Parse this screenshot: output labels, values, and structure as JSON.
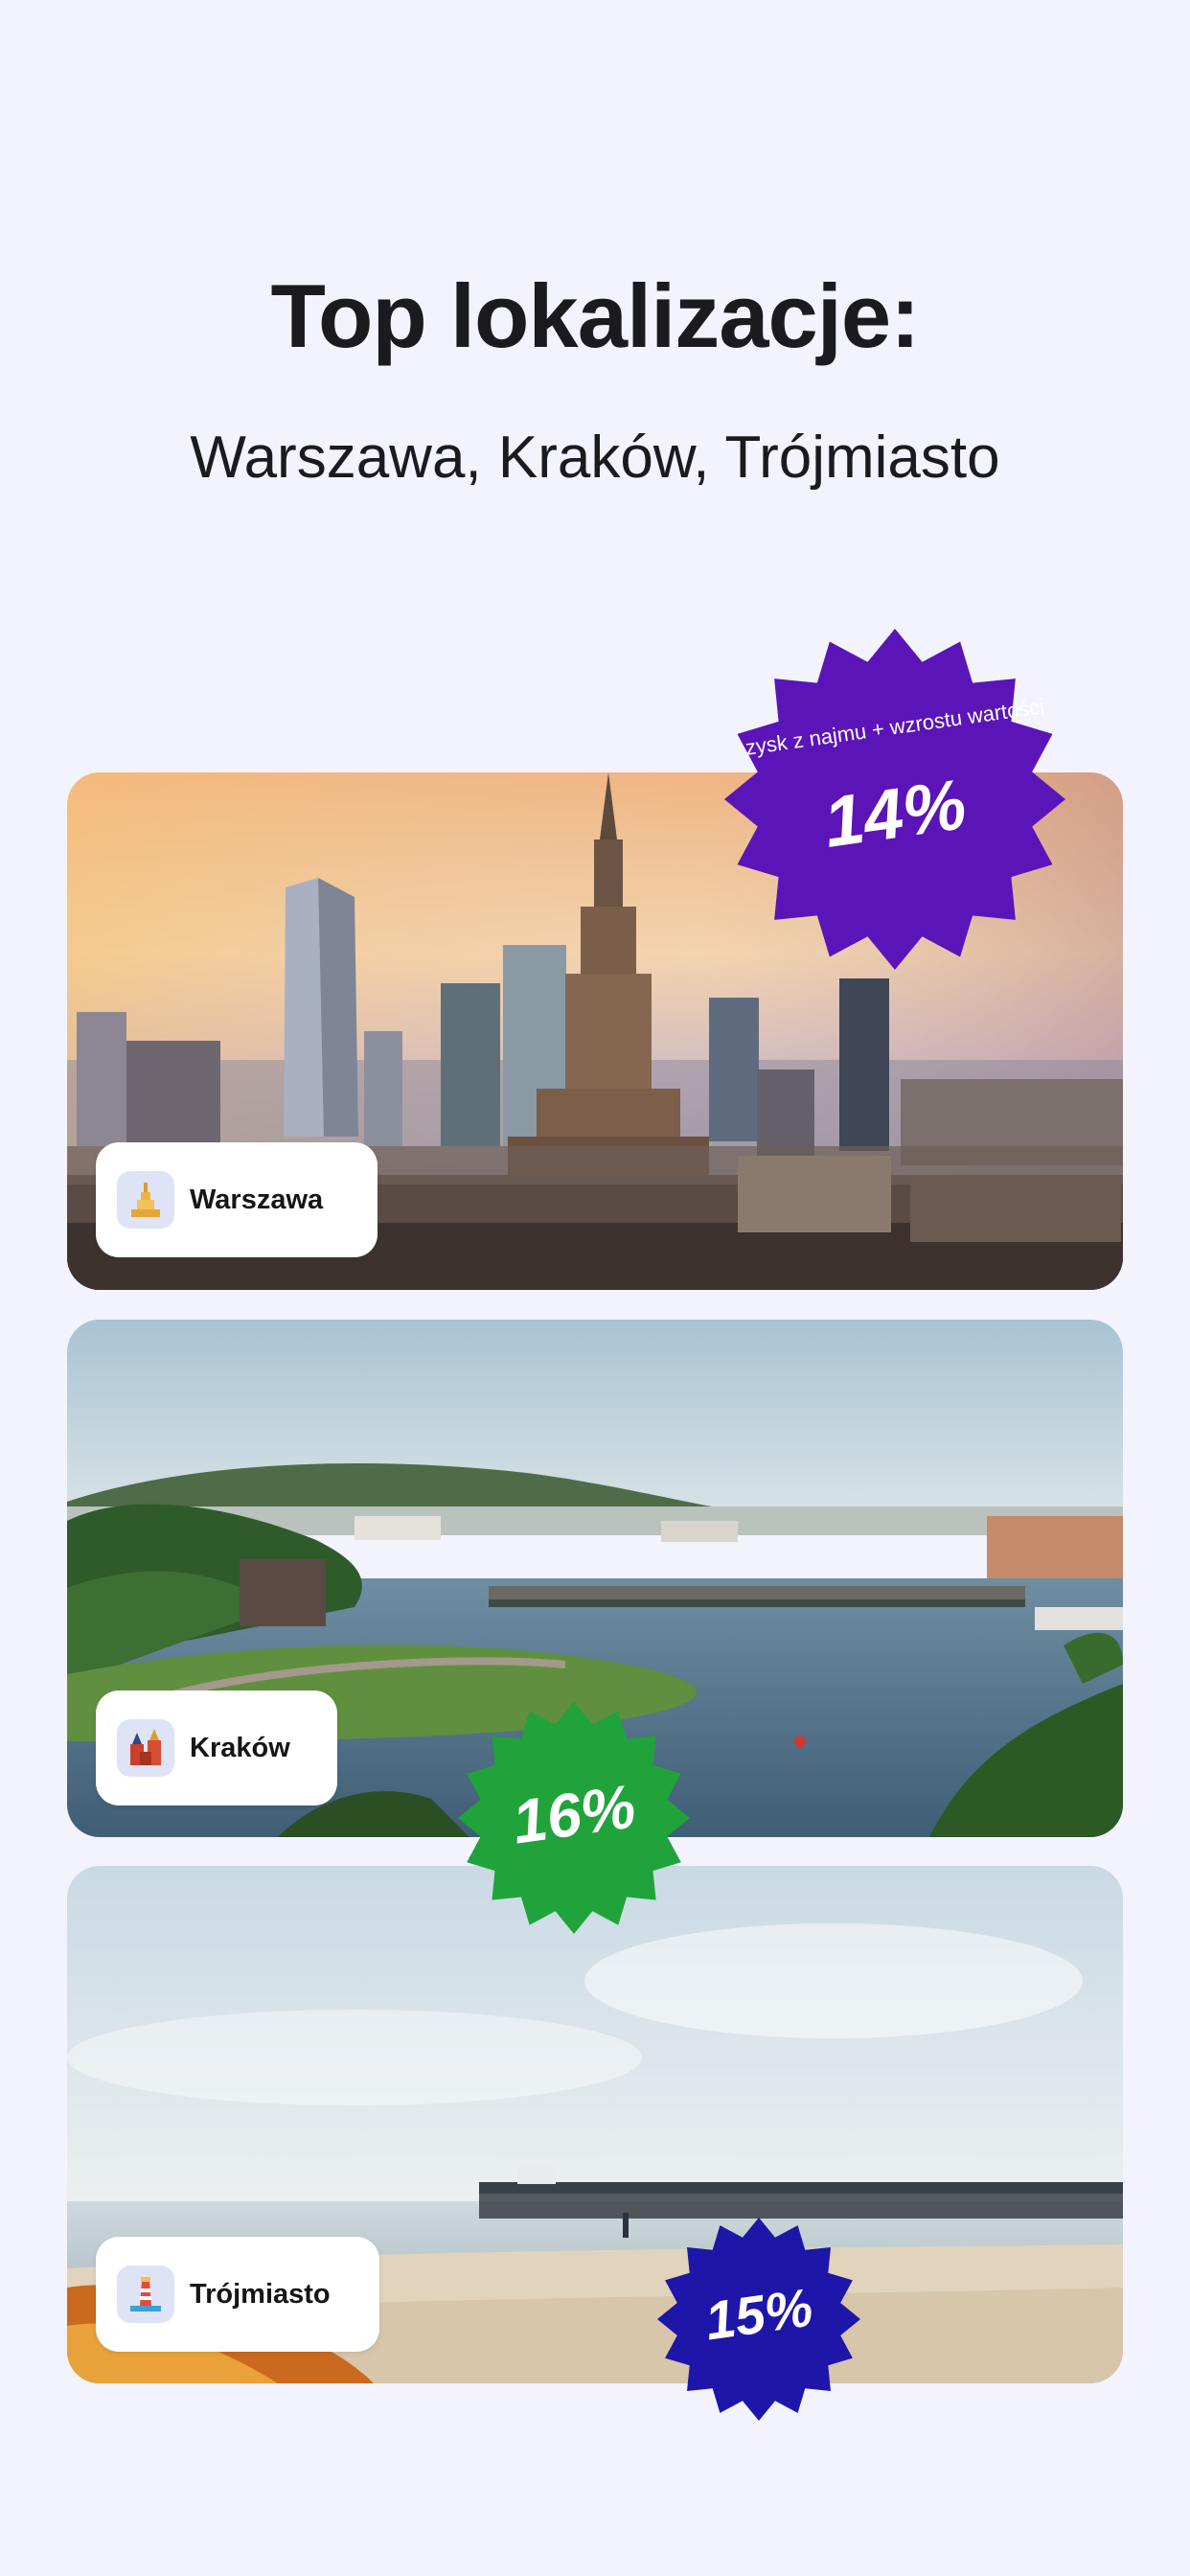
{
  "header": {
    "title": "Top lokalizacje:",
    "subtitle": "Warszawa, Kraków, Trójmiasto"
  },
  "locations": [
    {
      "name": "Warszawa",
      "icon": "palace-of-culture-icon",
      "badge": {
        "caption": "zysk z najmu + wzrostu wartości",
        "value": "14%",
        "color": "#5a14b8"
      }
    },
    {
      "name": "Kraków",
      "icon": "church-icon",
      "badge": {
        "value": "16%",
        "color": "#1fa33a"
      }
    },
    {
      "name": "Trójmiasto",
      "icon": "lighthouse-icon",
      "badge": {
        "value": "15%",
        "color": "#1e16a8"
      }
    }
  ]
}
